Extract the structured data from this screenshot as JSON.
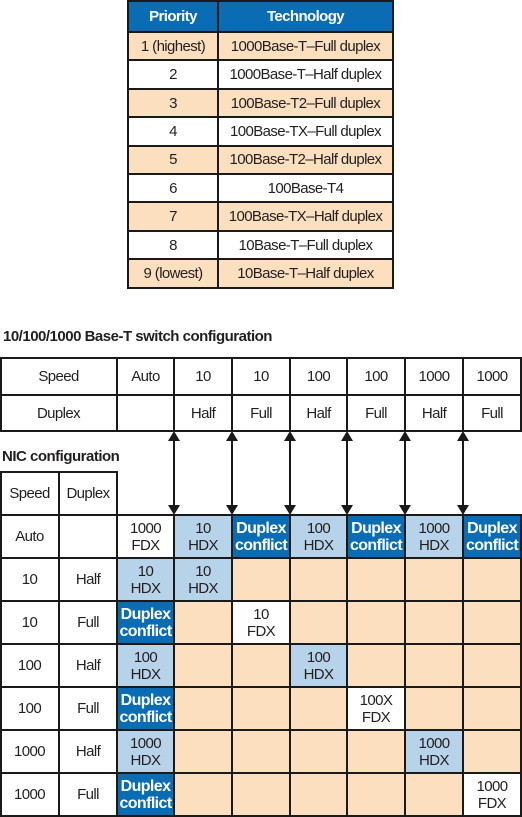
{
  "priority_table": {
    "headers": [
      "Priority",
      "Technology"
    ],
    "rows": [
      {
        "priority": "1 (highest)",
        "technology": "1000Base-T–Full duplex"
      },
      {
        "priority": "2",
        "technology": "1000Base-T–Half duplex"
      },
      {
        "priority": "3",
        "technology": "100Base-T2–Full duplex"
      },
      {
        "priority": "4",
        "technology": "100Base-TX–Full duplex"
      },
      {
        "priority": "5",
        "technology": "100Base-T2–Half duplex"
      },
      {
        "priority": "6",
        "technology": "100Base-T4"
      },
      {
        "priority": "7",
        "technology": "100Base-TX–Half duplex"
      },
      {
        "priority": "8",
        "technology": "10Base-T–Full duplex"
      },
      {
        "priority": "9 (lowest)",
        "technology": "10Base-T–Half duplex"
      }
    ]
  },
  "switch_config": {
    "title": "10/100/1000 Base-T switch configuration",
    "speed_label": "Speed",
    "duplex_label": "Duplex",
    "speeds": [
      "Auto",
      "10",
      "10",
      "100",
      "100",
      "1000",
      "1000"
    ],
    "duplexes": [
      "",
      "Half",
      "Full",
      "Half",
      "Full",
      "Half",
      "Full"
    ]
  },
  "nic_config": {
    "title": "NIC configuration",
    "speed_label": "Speed",
    "duplex_label": "Duplex",
    "rows": [
      {
        "speed": "Auto",
        "duplex": "",
        "cells": [
          {
            "l1": "1000",
            "l2": "FDX",
            "kind": "white"
          },
          {
            "l1": "10",
            "l2": "HDX",
            "kind": "blue"
          },
          {
            "l1": "Duplex",
            "l2": "conflict",
            "kind": "dark"
          },
          {
            "l1": "100",
            "l2": "HDX",
            "kind": "blue"
          },
          {
            "l1": "Duplex",
            "l2": "conflict",
            "kind": "dark"
          },
          {
            "l1": "1000",
            "l2": "HDX",
            "kind": "blue"
          },
          {
            "l1": "Duplex",
            "l2": "conflict",
            "kind": "dark"
          }
        ]
      },
      {
        "speed": "10",
        "duplex": "Half",
        "cells": [
          {
            "l1": "10",
            "l2": "HDX",
            "kind": "blue"
          },
          {
            "l1": "10",
            "l2": "HDX",
            "kind": "blue"
          },
          {
            "l1": "",
            "l2": "",
            "kind": "peach"
          },
          {
            "l1": "",
            "l2": "",
            "kind": "peach"
          },
          {
            "l1": "",
            "l2": "",
            "kind": "peach"
          },
          {
            "l1": "",
            "l2": "",
            "kind": "peach"
          },
          {
            "l1": "",
            "l2": "",
            "kind": "peach"
          }
        ]
      },
      {
        "speed": "10",
        "duplex": "Full",
        "cells": [
          {
            "l1": "Duplex",
            "l2": "conflict",
            "kind": "dark"
          },
          {
            "l1": "",
            "l2": "",
            "kind": "peach"
          },
          {
            "l1": "10",
            "l2": "FDX",
            "kind": "white"
          },
          {
            "l1": "",
            "l2": "",
            "kind": "peach"
          },
          {
            "l1": "",
            "l2": "",
            "kind": "peach"
          },
          {
            "l1": "",
            "l2": "",
            "kind": "peach"
          },
          {
            "l1": "",
            "l2": "",
            "kind": "peach"
          }
        ]
      },
      {
        "speed": "100",
        "duplex": "Half",
        "cells": [
          {
            "l1": "100",
            "l2": "HDX",
            "kind": "blue"
          },
          {
            "l1": "",
            "l2": "",
            "kind": "peach"
          },
          {
            "l1": "",
            "l2": "",
            "kind": "peach"
          },
          {
            "l1": "100",
            "l2": "HDX",
            "kind": "blue"
          },
          {
            "l1": "",
            "l2": "",
            "kind": "peach"
          },
          {
            "l1": "",
            "l2": "",
            "kind": "peach"
          },
          {
            "l1": "",
            "l2": "",
            "kind": "peach"
          }
        ]
      },
      {
        "speed": "100",
        "duplex": "Full",
        "cells": [
          {
            "l1": "Duplex",
            "l2": "conflict",
            "kind": "dark"
          },
          {
            "l1": "",
            "l2": "",
            "kind": "peach"
          },
          {
            "l1": "",
            "l2": "",
            "kind": "peach"
          },
          {
            "l1": "",
            "l2": "",
            "kind": "peach"
          },
          {
            "l1": "100X",
            "l2": "FDX",
            "kind": "white"
          },
          {
            "l1": "",
            "l2": "",
            "kind": "peach"
          },
          {
            "l1": "",
            "l2": "",
            "kind": "peach"
          }
        ]
      },
      {
        "speed": "1000",
        "duplex": "Half",
        "cells": [
          {
            "l1": "1000",
            "l2": "HDX",
            "kind": "blue"
          },
          {
            "l1": "",
            "l2": "",
            "kind": "peach"
          },
          {
            "l1": "",
            "l2": "",
            "kind": "peach"
          },
          {
            "l1": "",
            "l2": "",
            "kind": "peach"
          },
          {
            "l1": "",
            "l2": "",
            "kind": "peach"
          },
          {
            "l1": "1000",
            "l2": "HDX",
            "kind": "blue"
          },
          {
            "l1": "",
            "l2": "",
            "kind": "peach"
          }
        ]
      },
      {
        "speed": "1000",
        "duplex": "Full",
        "cells": [
          {
            "l1": "Duplex",
            "l2": "conflict",
            "kind": "dark"
          },
          {
            "l1": "",
            "l2": "",
            "kind": "peach"
          },
          {
            "l1": "",
            "l2": "",
            "kind": "peach"
          },
          {
            "l1": "",
            "l2": "",
            "kind": "peach"
          },
          {
            "l1": "",
            "l2": "",
            "kind": "peach"
          },
          {
            "l1": "",
            "l2": "",
            "kind": "peach"
          },
          {
            "l1": "1000",
            "l2": "FDX",
            "kind": "white"
          }
        ]
      }
    ]
  },
  "colors": {
    "header_blue": "#0a6cb3",
    "peach": "#fbdfbf",
    "light_blue": "#b7d3e9",
    "line": "#1a1a1a"
  }
}
